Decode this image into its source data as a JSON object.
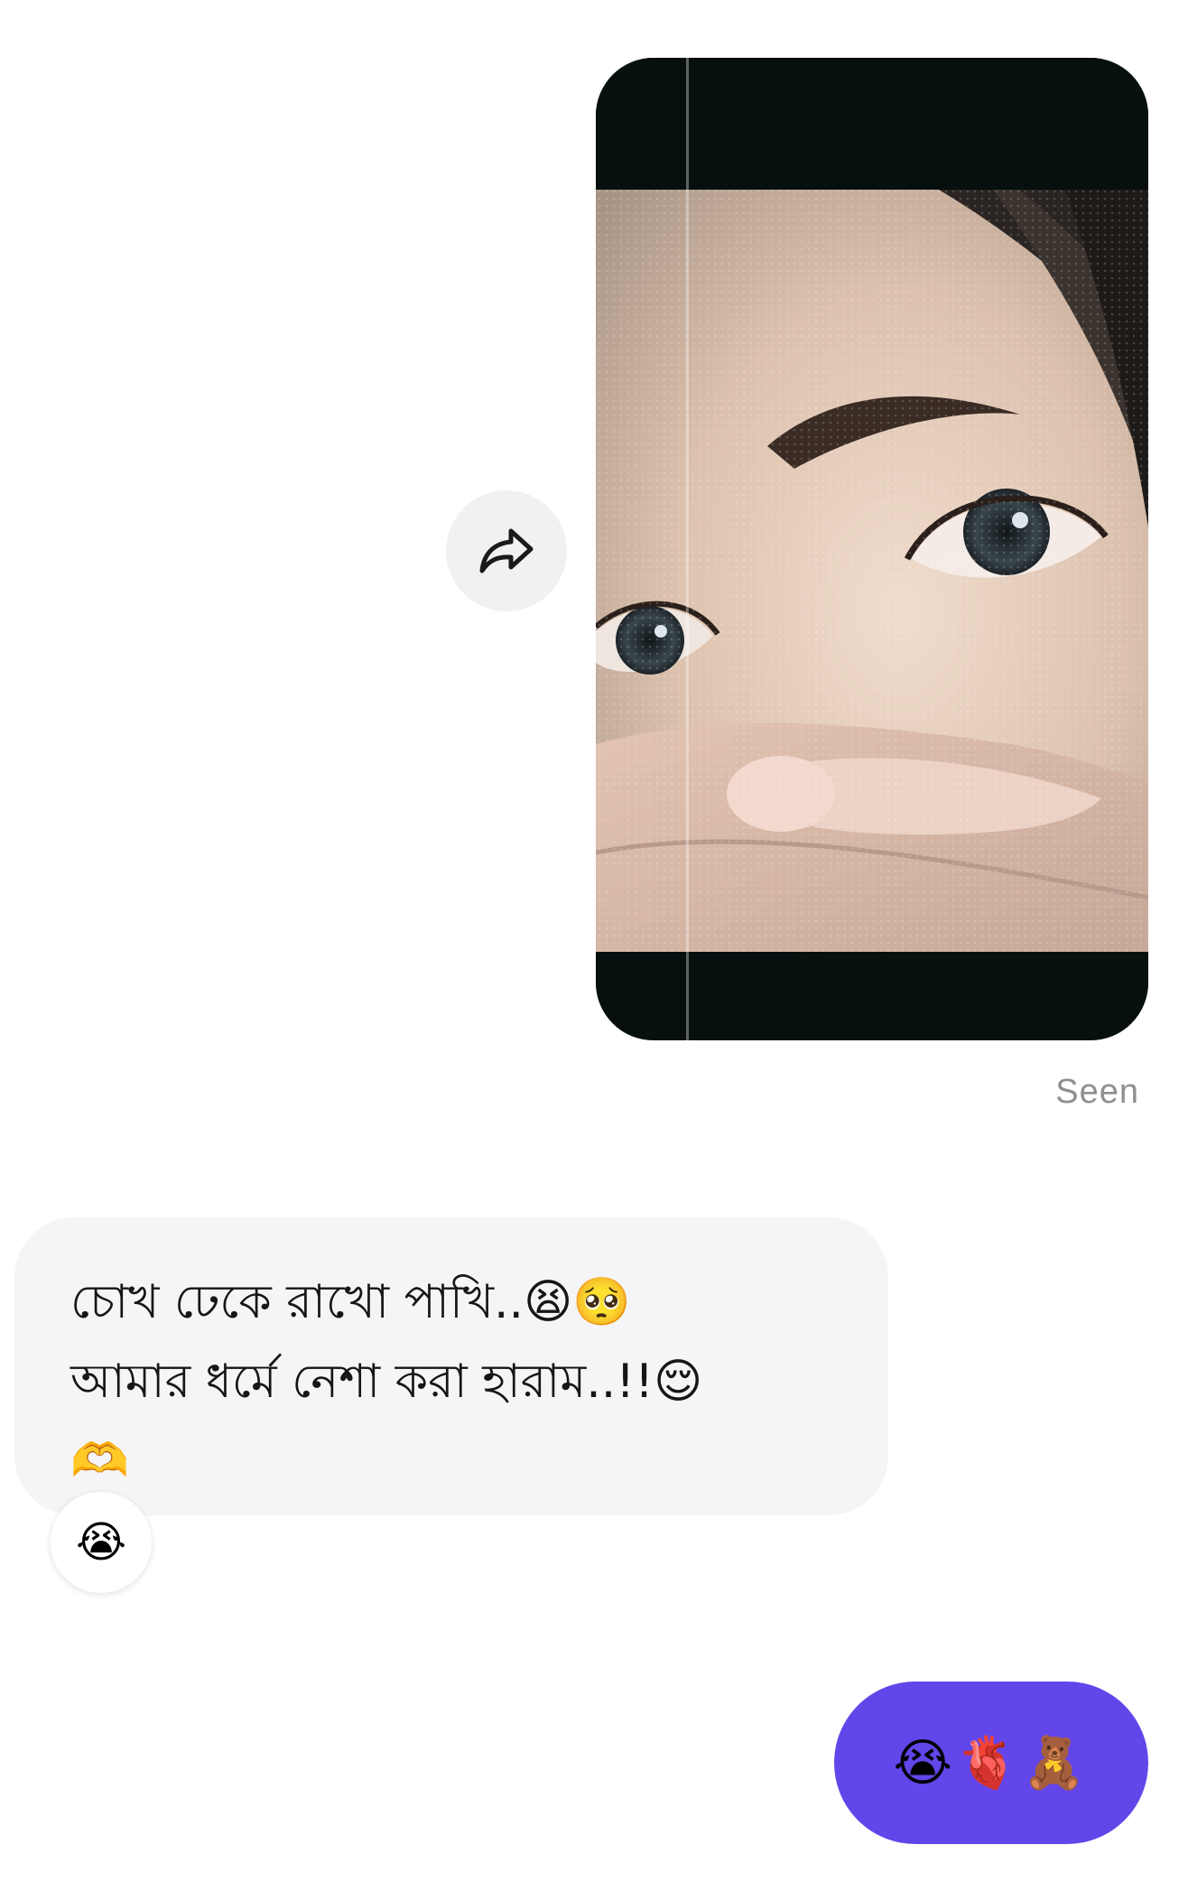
{
  "conversation": {
    "sent_photo": {
      "description_icon": "photo-message"
    },
    "share_icon": "share-arrow-icon",
    "status": {
      "seen": "Seen"
    },
    "incoming_message": {
      "text": "চোখ ঢেকে রাখো পাখি..😫🥺\nআমার ধর্মে নেশা করা হারাম..!!😌\n🫶",
      "reaction": "😭"
    },
    "outgoing_message": {
      "text": "😭🫀🧸"
    },
    "colors": {
      "outgoing_bubble": "#6246ea",
      "incoming_bubble": "#f5f5f7",
      "seen_text": "#8e8e93"
    }
  }
}
